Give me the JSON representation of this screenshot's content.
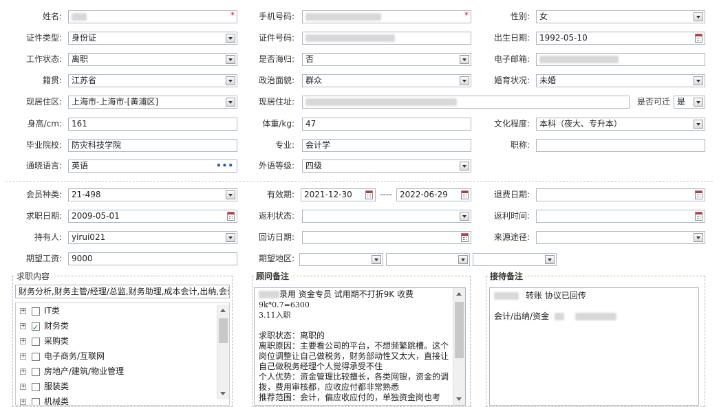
{
  "basic": {
    "name_label": "姓名:",
    "phone_label": "手机号码:",
    "gender_label": "性别:",
    "gender_value": "女",
    "id_type_label": "证件类型:",
    "id_type_value": "身份证",
    "id_no_label": "证件号码:",
    "birth_label": "出生日期:",
    "birth_value": "1992-05-10",
    "work_status_label": "工作状态:",
    "work_status_value": "离职",
    "returnee_label": "是否海归:",
    "returnee_value": "否",
    "email_label": "电子邮箱:",
    "native_label": "籍贯:",
    "native_value": "江苏省",
    "political_label": "政治面貌:",
    "political_value": "群众",
    "marital_label": "婚育状况:",
    "marital_value": "未婚",
    "current_area_label": "现居住区:",
    "current_area_value": "上海市-上海市-[黄浦区]",
    "current_addr_label": "现居住址:",
    "relocate_label": "是否可迁",
    "relocate_value": "是",
    "height_label": "身高/cm:",
    "height_value": "161",
    "weight_label": "体重/kg:",
    "weight_value": "47",
    "education_label": "文化程度:",
    "education_value": "本科（夜大、专升本）",
    "school_label": "毕业院校:",
    "school_value": "防灾科技学院",
    "major_label": "专业:",
    "major_value": "会计学",
    "title_label": "职称:",
    "language_label": "通晓语言:",
    "language_value": "英语",
    "lang_level_label": "外语等级:",
    "lang_level_value": "四级"
  },
  "member": {
    "type_label": "会员种类:",
    "type_value": "21-498",
    "valid_label": "有效期:",
    "valid_from": "2021-12-30",
    "valid_sep": "----",
    "valid_to": "2022-06-29",
    "refund_date_label": "退费日期:",
    "job_date_label": "求职日期:",
    "job_date_value": "2009-05-01",
    "rebate_status_label": "返利状态:",
    "rebate_time_label": "返利时间:",
    "holder_label": "持有人:",
    "holder_value": "yirui021",
    "visit_date_label": "回访日期:",
    "source_label": "来源途径:",
    "salary_label": "期望工资:",
    "salary_value": "9000",
    "area_label": "期望地区:"
  },
  "job_content": {
    "title": "求职内容",
    "summary": "财务分析,财务主管/经理/总监,财务助理,成本会计,出纳,会计",
    "tree": [
      {
        "label": "IT类",
        "checked": false
      },
      {
        "label": "财务类",
        "checked": true
      },
      {
        "label": "采购类",
        "checked": false
      },
      {
        "label": "电子商务/互联网",
        "checked": false
      },
      {
        "label": "房地产/建筑/物业管理",
        "checked": false
      },
      {
        "label": "服装类",
        "checked": false
      },
      {
        "label": "机械类",
        "checked": false
      }
    ]
  },
  "advisor_notes": {
    "title": "顾问备注",
    "line1_suffix": "录用  资金专员 试用期不打折9K  收费",
    "lines": [
      "9k*0.7=6300",
      "3.11入职",
      "",
      "求职状态：离职的",
      "离职原因：主要看公司的平台，不想频繁跳槽。这个岗位调整让自己做税务，财务部动性又太大，直接让自己做税务经理个人觉得承受不住",
      "个人优势：资金管理比较擅长，各类网银，资金的调拨，费用审核都，应收应付都非常熟悉",
      "推荐范围：会计，偏应收应付的，单独资金岗也考"
    ]
  },
  "reception_notes": {
    "title": "接待备注",
    "line1_suffix": "转账 协议已回传",
    "line2_prefix": "会计/出纳/资金"
  }
}
